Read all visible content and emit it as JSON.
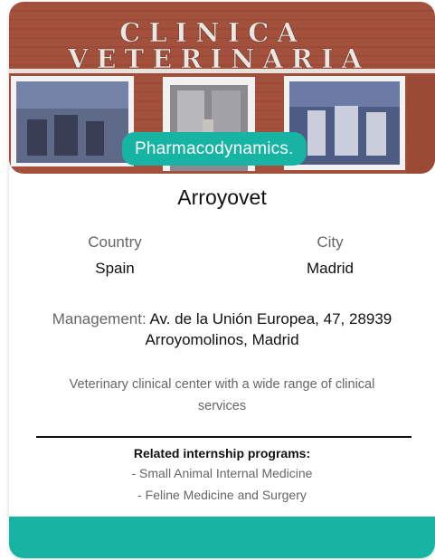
{
  "listing": {
    "photo": {
      "sign_line1": "CLINICA",
      "sign_line2": "VETERINARIA"
    },
    "badge": "Pharmacodynamics.",
    "name": "Arroyovet",
    "country_label": "Country",
    "country": "Spain",
    "city_label": "City",
    "city": "Madrid",
    "management_label": "Management:",
    "management_value": "Av. de la Unión Europea, 47, 28939 Arroyomolinos, Madrid",
    "description": "Veterinary clinical center with a wide range of clinical services",
    "related_title": "Related internship programs:",
    "related_programs": [
      "- Small Animal Internal Medicine",
      "- Feline Medicine and Surgery"
    ]
  },
  "colors": {
    "accent": "#17b3a3",
    "brick": "#a9503a"
  }
}
